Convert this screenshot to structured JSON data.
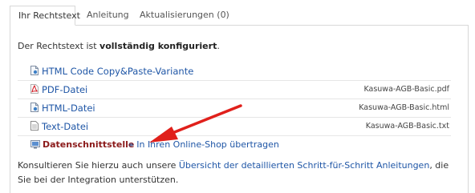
{
  "tabs": [
    {
      "label": "Ihr Rechtstext",
      "active": true
    },
    {
      "label": "Anleitung",
      "active": false
    },
    {
      "label": "Aktualisierungen (0)",
      "active": false
    }
  ],
  "intro": {
    "prefix": "Der Rechtstext ist ",
    "bold": "vollständig konfiguriert",
    "suffix": "."
  },
  "files": [
    {
      "icon": "html-page-icon",
      "label": "HTML Code Copy&Paste-Variante",
      "filename": ""
    },
    {
      "icon": "pdf-file-icon",
      "label": "PDF-Datei",
      "filename": "Kasuwa-AGB-Basic.pdf"
    },
    {
      "icon": "html-page-icon",
      "label": "HTML-Datei",
      "filename": "Kasuwa-AGB-Basic.html"
    },
    {
      "icon": "text-file-icon",
      "label": "Text-Datei",
      "filename": "Kasuwa-AGB-Basic.txt"
    }
  ],
  "interface": {
    "label": "Datenschnittstelle",
    "action": "» In Ihren Online-Shop übertragen"
  },
  "footer": {
    "prefix": "Konsultieren Sie hierzu auch unsere ",
    "link": "Übersicht der detaillierten Schritt-für-Schritt Anleitungen",
    "suffix": ", die Sie bei der Integration unterstützen."
  },
  "colors": {
    "link": "#1f56a6",
    "interface_label": "#8b1a1a",
    "arrow": "#e0201b"
  }
}
